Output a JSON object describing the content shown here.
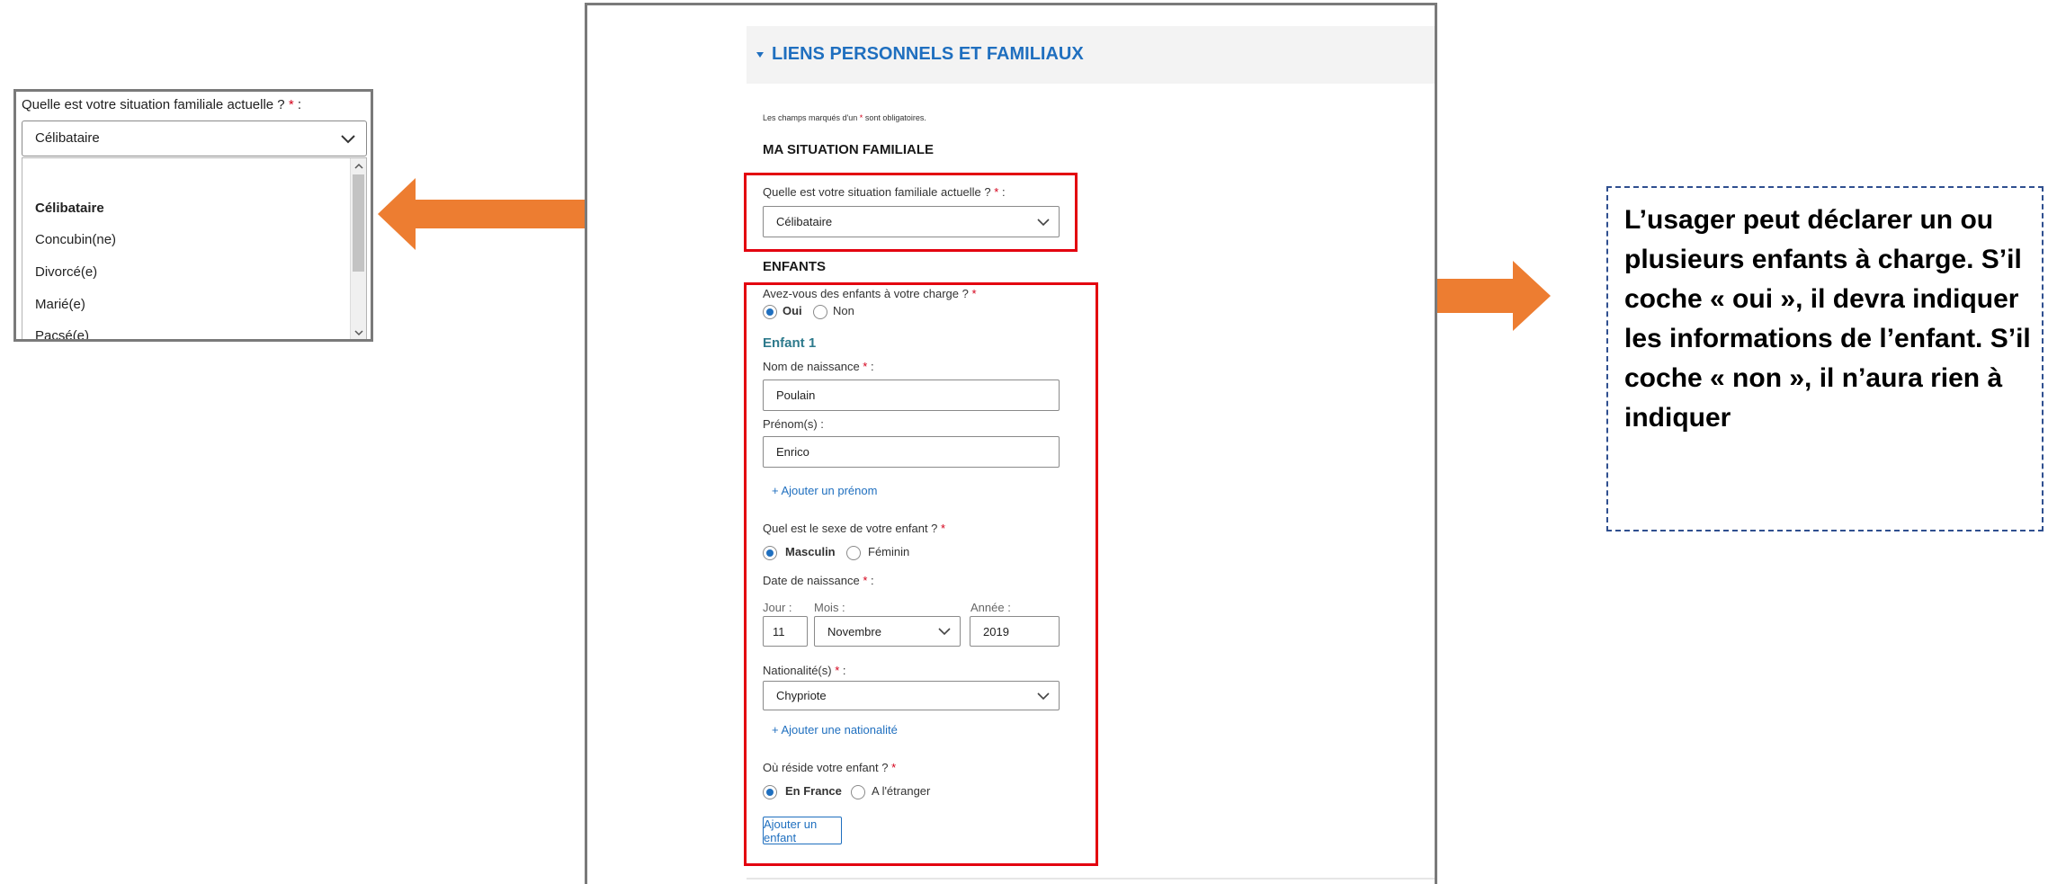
{
  "zoom": {
    "question": "Quelle est votre situation familiale actuelle ?",
    "required_mark": "*",
    "suffix": " :",
    "selected_value": "Célibataire",
    "options": [
      "Célibataire",
      "Concubin(ne)",
      "Divorcé(e)",
      "Marié(e)",
      "Pacsé(e)"
    ]
  },
  "form": {
    "section_title": "LIENS PERSONNELS ET FAMILIAUX",
    "mandatory_note_prefix": "Les champs marqués d'un",
    "mandatory_note_star": "*",
    "mandatory_note_suffix": "sont obligatoires.",
    "heading_situation": "MA SITUATION FAMILIALE",
    "situation_question": "Quelle est votre situation familiale actuelle ?",
    "situation_value": "Célibataire",
    "heading_children": "ENFANTS",
    "children_question": "Avez-vous des enfants à votre charge ?",
    "opt_yes": "Oui",
    "opt_no": "Non",
    "child_title": "Enfant 1",
    "birth_name_label": "Nom de naissance",
    "birth_name_value": "Poulain",
    "first_names_label": "Prénom(s) :",
    "first_names_value": "Enrico",
    "add_first_name": "+ Ajouter un prénom",
    "sex_question": "Quel est le sexe de votre enfant ?",
    "opt_male": "Masculin",
    "opt_female": "Féminin",
    "birth_date_label": "Date de naissance",
    "day_label": "Jour :",
    "month_label": "Mois :",
    "year_label": "Année :",
    "day_value": "11",
    "month_value": "Novembre",
    "year_value": "2019",
    "nationality_label": "Nationalité(s)",
    "nationality_value": "Chypriote",
    "add_nationality": "+ Ajouter une nationalité",
    "residence_question": "Où réside votre enfant ?",
    "opt_france": "En France",
    "opt_abroad": "A l'étranger",
    "add_child_button": "Ajouter un enfant",
    "star": "*",
    "colon": " :"
  },
  "note": {
    "text": "L’usager peut déclarer un ou plusieurs enfants à charge. S’il coche « oui », il devra indiquer les informations de l’enfant. S’il coche « non », il n’aura rien à indiquer"
  },
  "colors": {
    "arrow": "#ed7d31",
    "highlight": "#e3000f",
    "link_blue": "#1f6fbf",
    "note_border": "#2f4f8f"
  }
}
